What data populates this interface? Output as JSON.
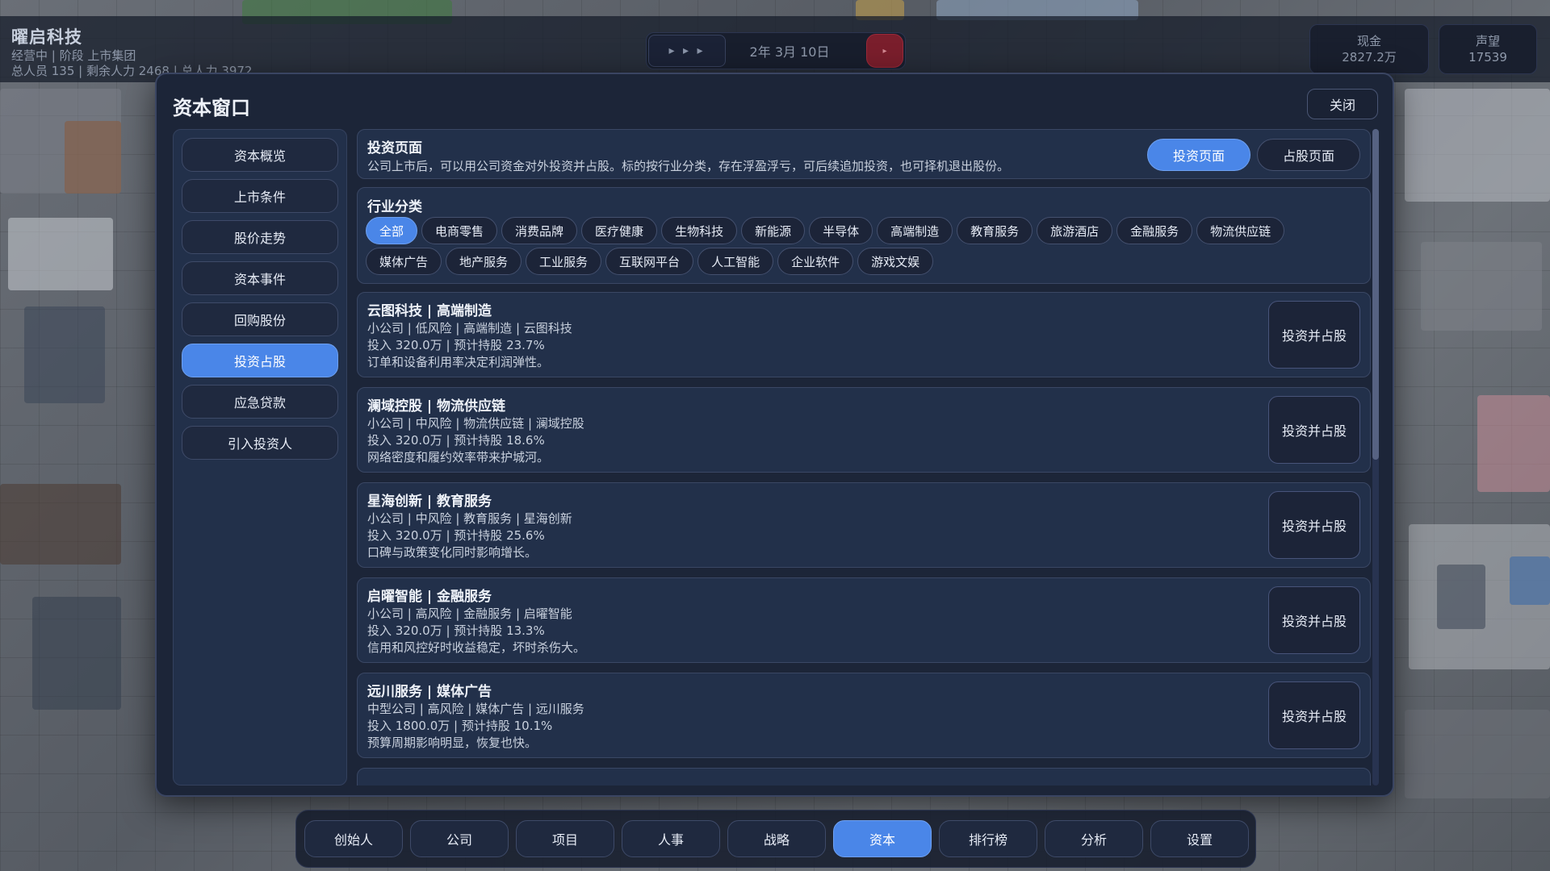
{
  "hud": {
    "company_name": "曜启科技",
    "status_line": "经营中 | 阶段 上市集团",
    "people_line": "总人员 135 | 剩余人力 2468 | 总人力 3972",
    "speed_label": "▸ ▸ ▸",
    "date": "2年 3月 10日",
    "pause_label": "▸",
    "cash_label": "现金",
    "cash_value": "2827.2万",
    "reputation_label": "声望",
    "reputation_value": "17539"
  },
  "modal": {
    "title": "资本窗口",
    "close_label": "关闭"
  },
  "sidebar": {
    "items": [
      {
        "label": "资本概览"
      },
      {
        "label": "上市条件"
      },
      {
        "label": "股价走势"
      },
      {
        "label": "资本事件"
      },
      {
        "label": "回购股份"
      },
      {
        "label": "投资占股"
      },
      {
        "label": "应急贷款"
      },
      {
        "label": "引入投资人"
      }
    ],
    "active_index": 5
  },
  "header_card": {
    "title": "投资页面",
    "description": "公司上市后，可以用公司资金对外投资并占股。标的按行业分类，存在浮盈浮亏，可后续追加投资，也可择机退出股份。",
    "tab_invest": "投资页面",
    "tab_holdings": "占股页面"
  },
  "industry": {
    "title": "行业分类",
    "row1": [
      "全部",
      "电商零售",
      "消费品牌",
      "医疗健康",
      "生物科技",
      "新能源",
      "半导体",
      "高端制造",
      "教育服务",
      "旅游酒店",
      "金融服务",
      "物流供应链"
    ],
    "row2": [
      "媒体广告",
      "地产服务",
      "工业服务",
      "互联网平台",
      "人工智能",
      "企业软件",
      "游戏文娱"
    ]
  },
  "investments": [
    {
      "title": "云图科技 | 高端制造",
      "meta": "小公司 | 低风险 | 高端制造 | 云图科技",
      "stake": "投入 320.0万 | 预计持股 23.7%",
      "note": "订单和设备利用率决定利润弹性。",
      "button": "投资并占股"
    },
    {
      "title": "澜域控股 | 物流供应链",
      "meta": "小公司 | 中风险 | 物流供应链 | 澜域控股",
      "stake": "投入 320.0万 | 预计持股 18.6%",
      "note": "网络密度和履约效率带来护城河。",
      "button": "投资并占股"
    },
    {
      "title": "星海创新 | 教育服务",
      "meta": "小公司 | 中风险 | 教育服务 | 星海创新",
      "stake": "投入 320.0万 | 预计持股 25.6%",
      "note": "口碑与政策变化同时影响增长。",
      "button": "投资并占股"
    },
    {
      "title": "启曜智能 | 金融服务",
      "meta": "小公司 | 高风险 | 金融服务 | 启曜智能",
      "stake": "投入 320.0万 | 预计持股 13.3%",
      "note": "信用和风控好时收益稳定，坏时杀伤大。",
      "button": "投资并占股"
    },
    {
      "title": "远川服务 | 媒体广告",
      "meta": "中型公司 | 高风险 | 媒体广告 | 远川服务",
      "stake": "投入 1800.0万 | 预计持股 10.1%",
      "note": "预算周期影响明显，恢复也快。",
      "button": "投资并占股"
    }
  ],
  "bottom_nav": {
    "items": [
      {
        "label": "创始人"
      },
      {
        "label": "公司"
      },
      {
        "label": "项目"
      },
      {
        "label": "人事"
      },
      {
        "label": "战略"
      },
      {
        "label": "资本"
      },
      {
        "label": "排行榜"
      },
      {
        "label": "分析"
      },
      {
        "label": "设置"
      }
    ],
    "active_index": 5
  },
  "colors": {
    "accent": "#4a86e8",
    "panel": "#1c2538",
    "card": "#22304a",
    "danger": "#7a1e2c"
  }
}
